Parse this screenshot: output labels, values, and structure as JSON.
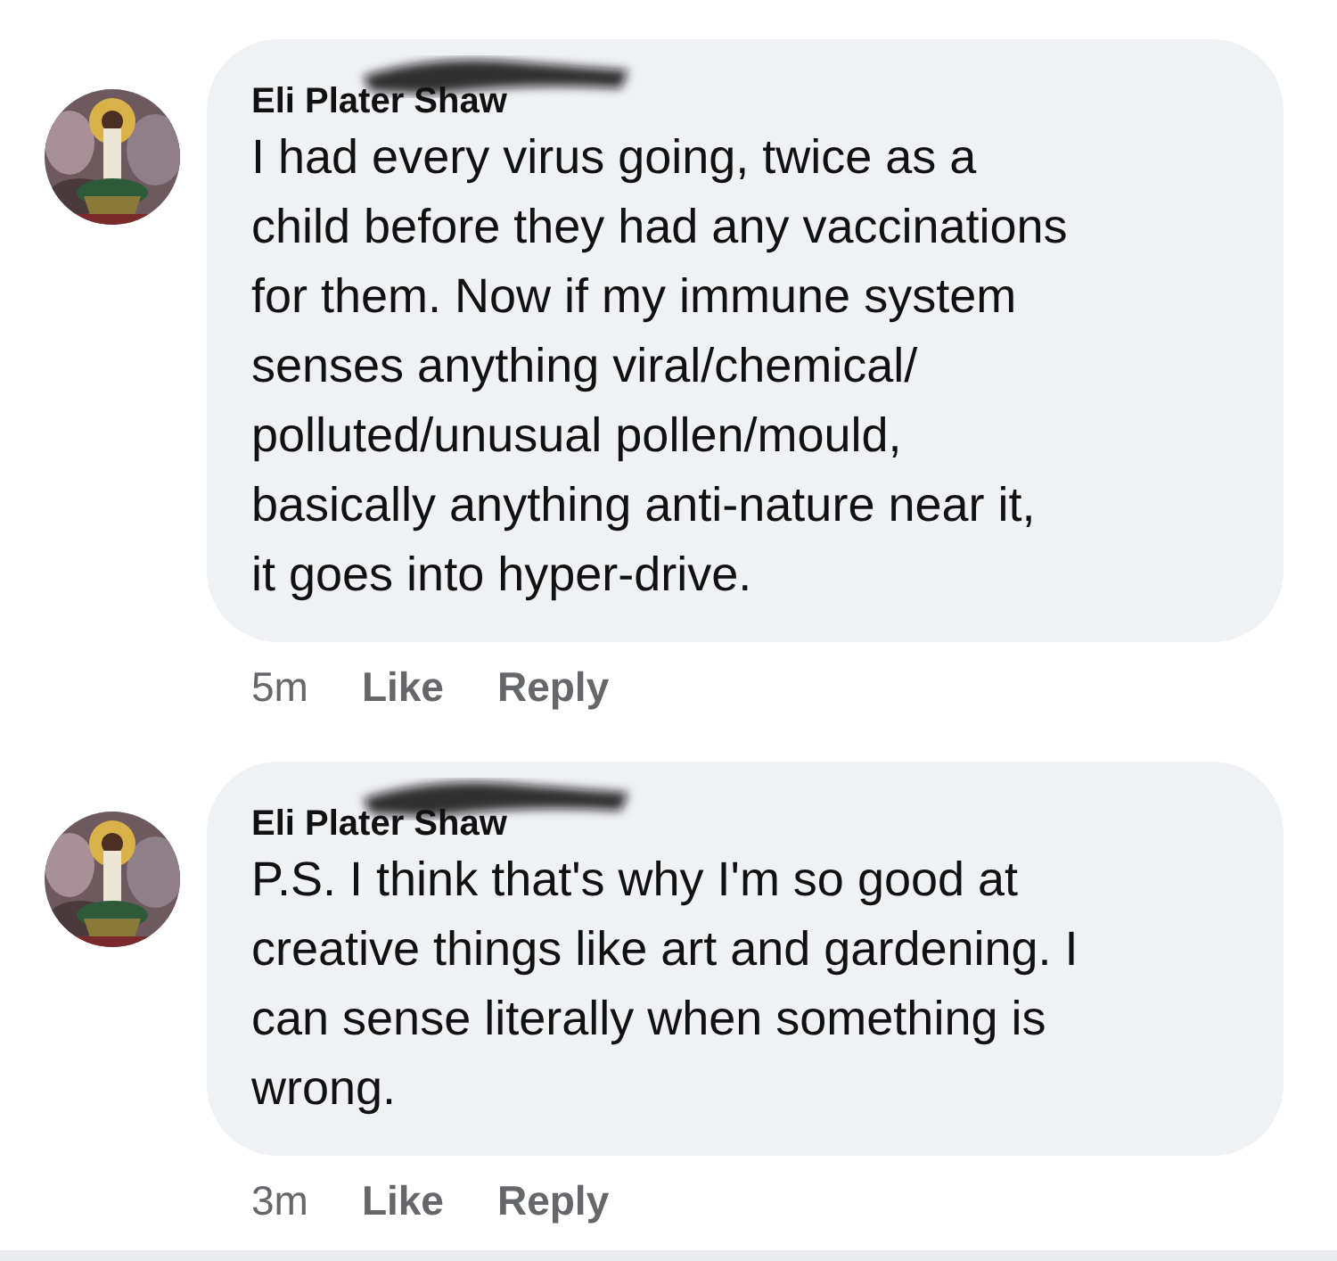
{
  "comments": [
    {
      "author": "Eli Plater Shaw",
      "text": "I had every virus going, twice as a\nchild before they had any vaccinations\nfor them. Now if my immune system\nsenses anything viral/chemical/\npolluted/unusual pollen/mould,\nbasically anything anti-nature near it,\nit goes into hyper-drive.",
      "time": "5m",
      "actions": [
        "Like",
        "Reply"
      ]
    },
    {
      "author": "Eli Plater Shaw",
      "text": "P.S. I think that's why I'm so good at\ncreative things like art and gardening. I\ncan sense literally when something is\nwrong.",
      "time": "3m",
      "actions": [
        "Like",
        "Reply"
      ]
    }
  ]
}
